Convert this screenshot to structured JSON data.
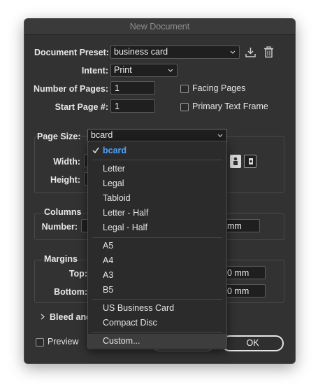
{
  "window": {
    "title": "New Document"
  },
  "preset": {
    "label": "Document Preset:",
    "value": "business card"
  },
  "intent": {
    "label": "Intent:",
    "value": "Print"
  },
  "pages": {
    "label": "Number of Pages:",
    "value": "1"
  },
  "start_page": {
    "label": "Start Page #:",
    "value": "1"
  },
  "facing_pages": {
    "label": "Facing Pages",
    "checked": false
  },
  "primary_text_frame": {
    "label": "Primary Text Frame",
    "checked": false
  },
  "page_size": {
    "label": "Page Size:",
    "value": "bcard",
    "width_label": "Width:",
    "height_label": "Height:",
    "menu": {
      "selected": "bcard",
      "items": [
        "bcard",
        "Letter",
        "Legal",
        "Tabloid",
        "Letter - Half",
        "Legal - Half",
        "A5",
        "A4",
        "A3",
        "B5",
        "US Business Card",
        "Compact Disc",
        "Custom..."
      ]
    }
  },
  "columns": {
    "title": "Columns",
    "number_label": "Number:",
    "gutter_tail": "mm"
  },
  "margins": {
    "title": "Margins",
    "top_label": "Top:",
    "bottom_label": "Bottom:",
    "top_tail": "0 mm",
    "bottom_tail": "0 mm"
  },
  "bleed": {
    "label": "Bleed and"
  },
  "preview": {
    "label": "Preview",
    "checked": false
  },
  "ok_button": {
    "label": "OK"
  },
  "colors": {
    "dialog_bg": "#323232",
    "menu_bg": "#2b2b2b",
    "accent": "#4aa3ff",
    "hover_row": "#3d3d3d"
  }
}
